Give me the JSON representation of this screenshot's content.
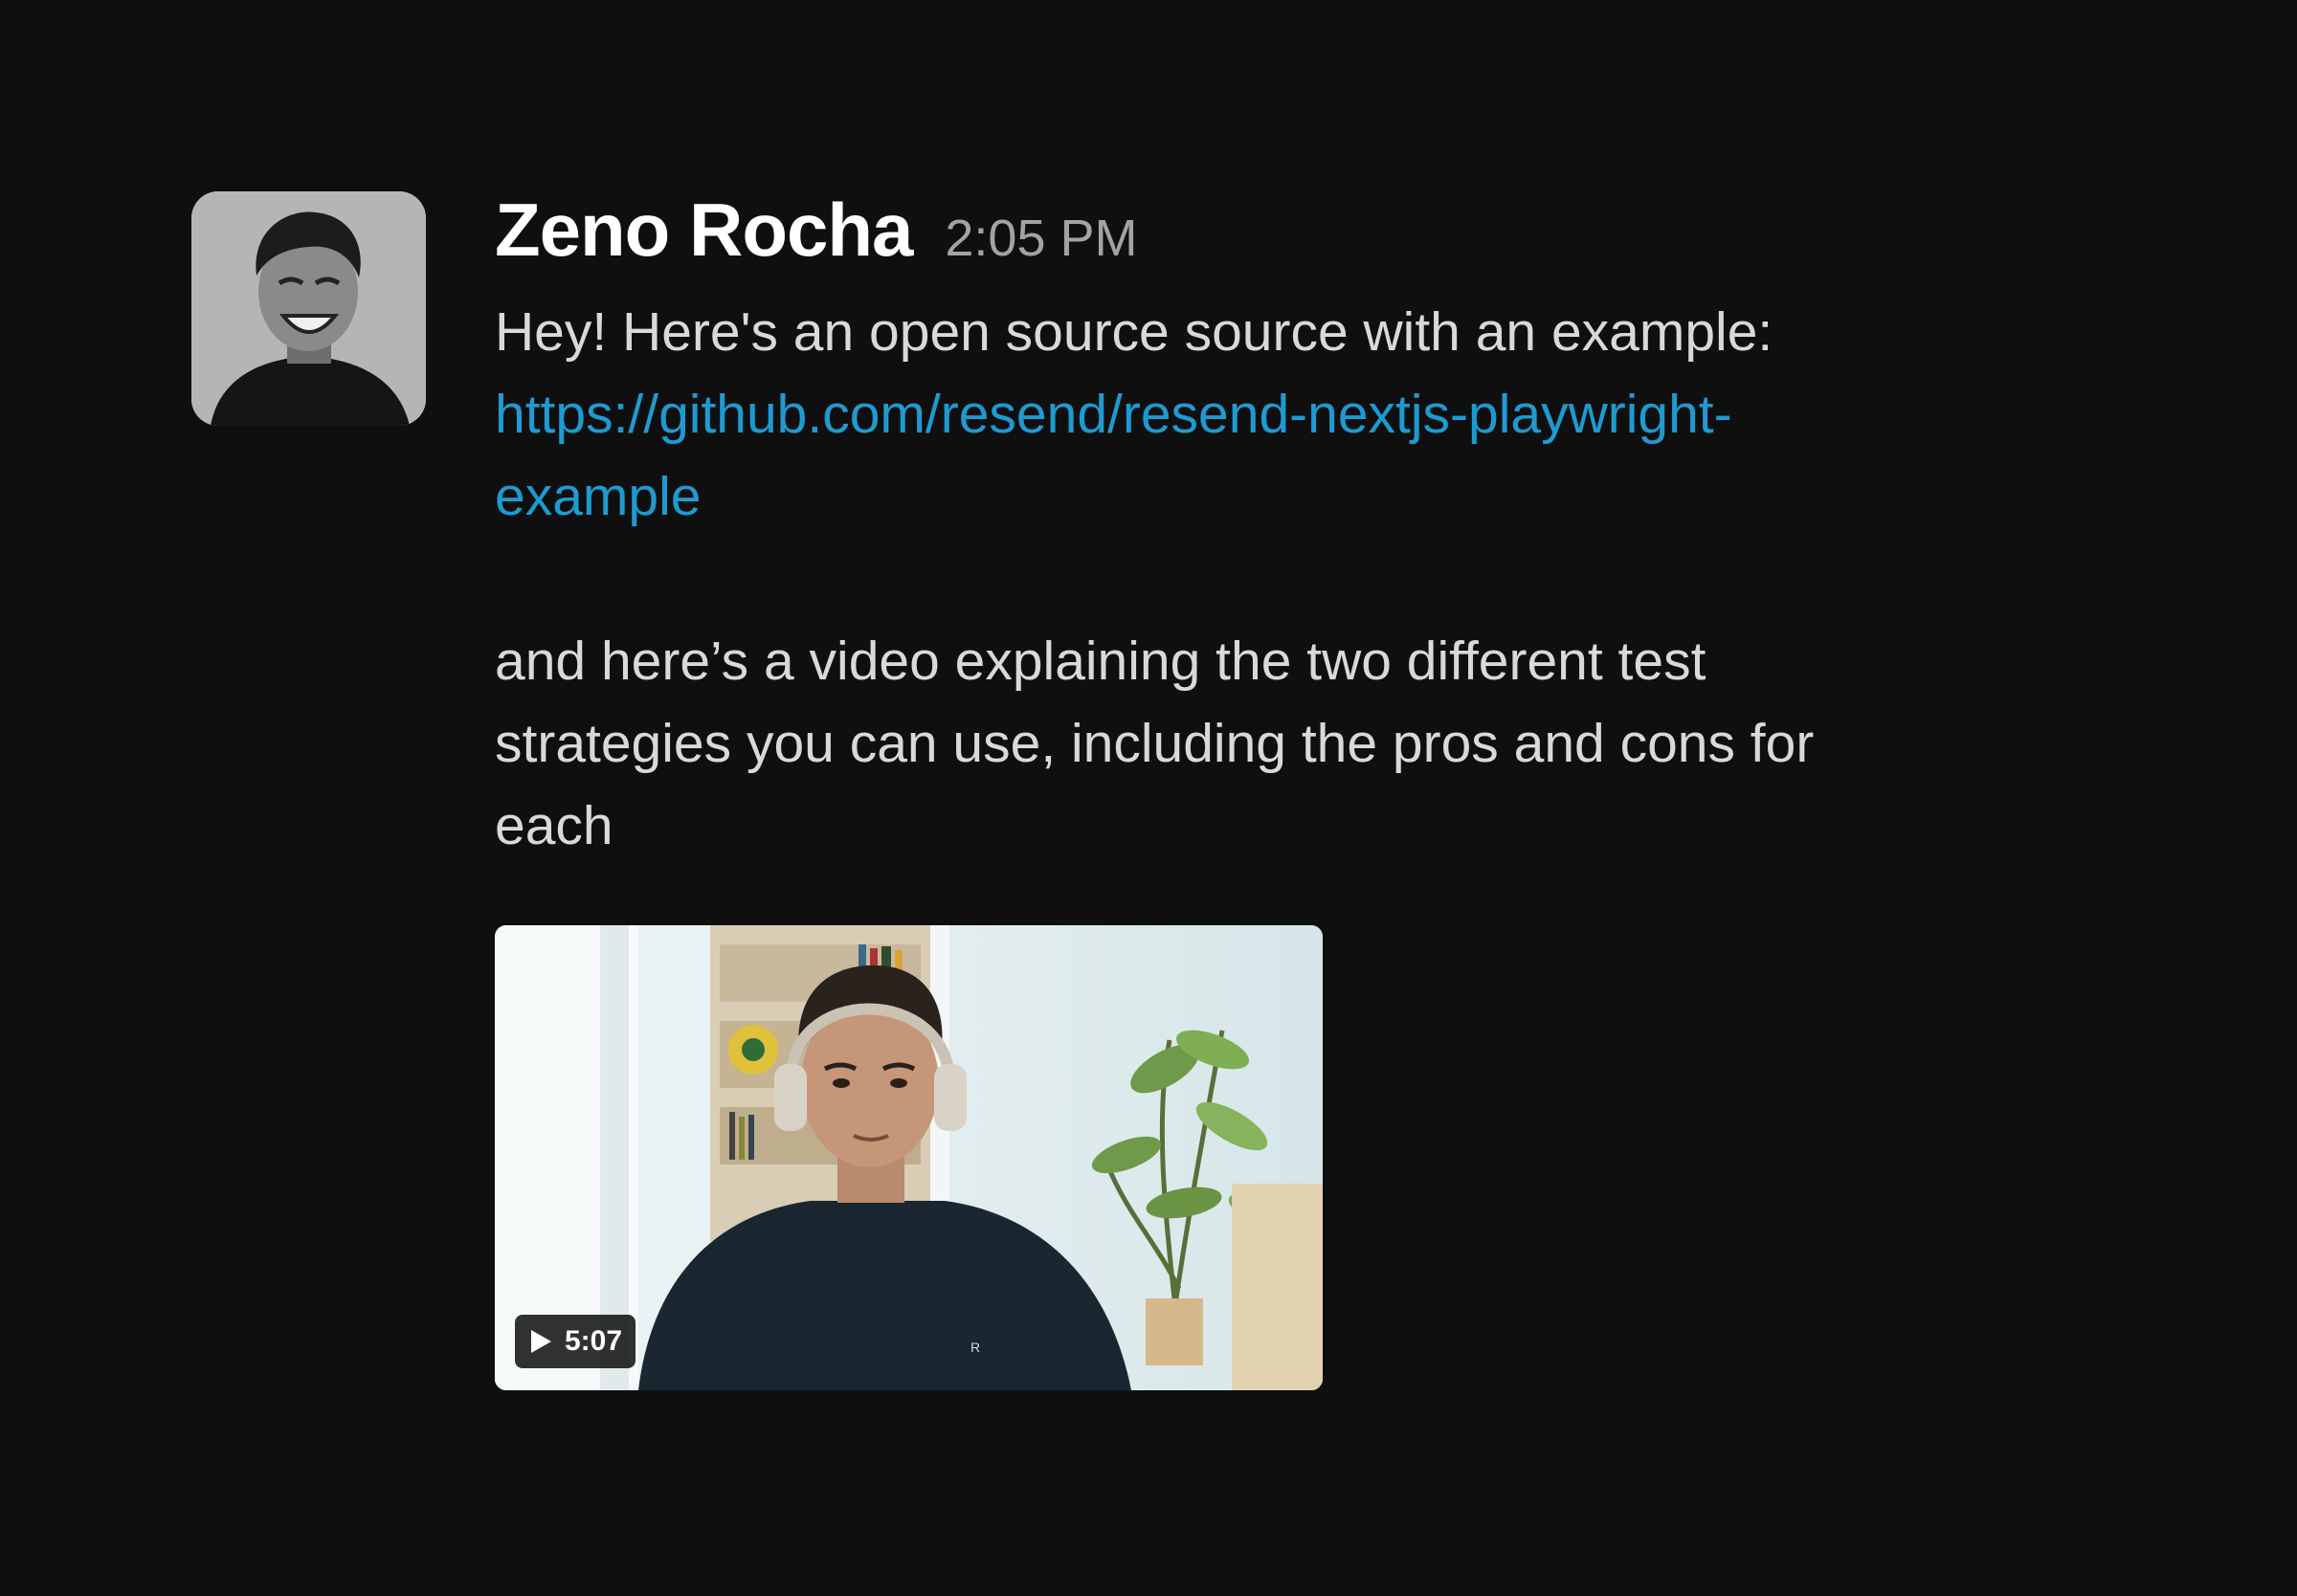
{
  "message": {
    "author": "Zeno Rocha",
    "timestamp": "2:05 PM",
    "text_line_1": "Hey! Here's an open source source with an example:",
    "link": "https://github.com/resend/resend-nextjs-playwright-example",
    "paragraph_2": "and here’s a video explaining the two different test strategies you can use, including the pros and cons for each"
  },
  "video": {
    "duration": "5:07",
    "icon": "play-icon"
  },
  "colors": {
    "background": "#0f0f10",
    "link": "#1d9bd1",
    "text": "#d9d9d9",
    "timestamp": "#a3a3a3"
  }
}
